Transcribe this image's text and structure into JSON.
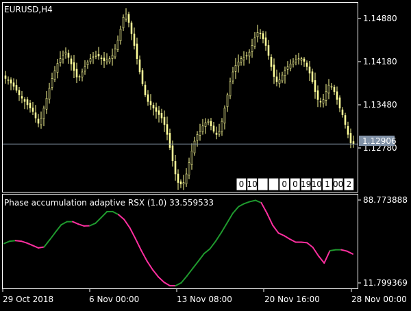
{
  "window": {
    "symbol_label": "EURUSD,H4"
  },
  "colors": {
    "background": "#000000",
    "frame": "#ffffff",
    "candles": "#ffff99",
    "rsx_up": "#1f9a2e",
    "rsx_down": "#ff2fa0",
    "current_price_line": "#8899aa",
    "price_marker_bg": "#8091a6"
  },
  "price_axis": {
    "labels": [
      "1.14880",
      "1.14180",
      "1.13480",
      "1.12780"
    ],
    "current_price": "1.12906"
  },
  "indicator": {
    "name": "Phase accumulation adaptive RSX (1.0)",
    "value": "33.559533",
    "scale_max": "88.773888",
    "scale_min": "11.799369"
  },
  "time_axis": {
    "labels": [
      "29 Oct 2018",
      "6 Nov 00:00",
      "13 Nov 08:00",
      "20 Nov 16:00",
      "28 Nov 00:00"
    ]
  },
  "period_boxes": [
    "0",
    "10",
    "",
    "",
    "0",
    "0",
    "19",
    "10",
    "1",
    "00",
    "2"
  ],
  "chart_data": [
    {
      "type": "candlestick",
      "title": "EURUSD,H4",
      "y_ticks": [
        1.1488,
        1.1418,
        1.1348,
        1.1278
      ],
      "ylim": [
        1.1218,
        1.1505
      ],
      "current_price": 1.12906,
      "x_tick_labels": [
        "29 Oct 2018",
        "6 Nov 00:00",
        "13 Nov 08:00",
        "20 Nov 16:00",
        "28 Nov 00:00"
      ],
      "close_path": [
        1.139,
        1.1388,
        1.1383,
        1.1378,
        1.1372,
        1.1365,
        1.136,
        1.1355,
        1.135,
        1.1345,
        1.134,
        1.133,
        1.1322,
        1.133,
        1.1345,
        1.136,
        1.1375,
        1.139,
        1.1402,
        1.1413,
        1.142,
        1.1425,
        1.143,
        1.1422,
        1.1412,
        1.1402,
        1.1392,
        1.1393,
        1.14,
        1.1408,
        1.1415,
        1.142,
        1.1423,
        1.1425,
        1.1424,
        1.142,
        1.1417,
        1.1418,
        1.142,
        1.1425,
        1.1435,
        1.1448,
        1.1465,
        1.1483,
        1.1488,
        1.1475,
        1.1458,
        1.144,
        1.142,
        1.14,
        1.1382,
        1.1365,
        1.1355,
        1.135,
        1.1345,
        1.134,
        1.1335,
        1.133,
        1.132,
        1.1305,
        1.1285,
        1.1265,
        1.1245,
        1.1232,
        1.123,
        1.1232,
        1.1245,
        1.1262,
        1.128,
        1.1295,
        1.1305,
        1.131,
        1.1318,
        1.1323,
        1.1325,
        1.1318,
        1.131,
        1.1305,
        1.131,
        1.1325,
        1.1345,
        1.1365,
        1.1385,
        1.14,
        1.141,
        1.1415,
        1.142,
        1.1422,
        1.1425,
        1.143,
        1.144,
        1.1452,
        1.146,
        1.1458,
        1.145,
        1.144,
        1.1425,
        1.1408,
        1.1393,
        1.1385,
        1.1388,
        1.1395,
        1.1402,
        1.1408,
        1.1412,
        1.1415,
        1.1418,
        1.142,
        1.142,
        1.1416,
        1.1408,
        1.1398,
        1.1385,
        1.137,
        1.1358,
        1.1355,
        1.1358,
        1.137,
        1.138,
        1.1378,
        1.137,
        1.1358,
        1.1345,
        1.1335,
        1.132,
        1.1305,
        1.1292,
        1.1291
      ]
    },
    {
      "type": "line",
      "title": "Phase accumulation adaptive RSX (1.0) 33.559533",
      "ylim": [
        11.799369,
        88.773888
      ],
      "x_tick_labels": [
        "29 Oct 2018",
        "6 Nov 00:00",
        "13 Nov 08:00",
        "20 Nov 16:00",
        "28 Nov 00:00"
      ],
      "values": [
        48.6,
        50.5,
        51.0,
        50.5,
        49.0,
        47.0,
        45.0,
        45.8,
        51.8,
        58.0,
        64.0,
        66.5,
        66.5,
        64.5,
        63.0,
        63.2,
        65.3,
        70.0,
        74.7,
        74.8,
        72.3,
        68.3,
        61.4,
        52.4,
        42.8,
        34.2,
        27.0,
        21.1,
        16.8,
        14.0,
        14.0,
        16.4,
        22.1,
        28.2,
        34.2,
        40.4,
        44.2,
        50.4,
        57.6,
        65.4,
        73.3,
        78.8,
        81.3,
        83.0,
        84.0,
        82.0,
        73.4,
        63.5,
        57.2,
        55.0,
        52.2,
        49.7,
        49.7,
        49.2,
        45.5,
        38.5,
        32.6,
        42.7,
        43.5,
        43.5,
        42.3,
        40.0
      ],
      "colors": [
        "#1f9a2e",
        "#ff2fa0"
      ],
      "segments_direction": [
        "up",
        "up",
        "down",
        "down",
        "down",
        "down",
        "down",
        "up",
        "up",
        "up",
        "up",
        "up",
        "down",
        "down",
        "down",
        "up",
        "up",
        "up",
        "up",
        "up",
        "down",
        "down",
        "down",
        "down",
        "down",
        "down",
        "down",
        "down",
        "down",
        "down",
        "up",
        "up",
        "up",
        "up",
        "up",
        "up",
        "up",
        "up",
        "up",
        "up",
        "up",
        "up",
        "up",
        "up",
        "up",
        "down",
        "down",
        "down",
        "down",
        "down",
        "down",
        "down",
        "down",
        "down",
        "down",
        "down",
        "down",
        "up",
        "up",
        "down",
        "down",
        "down"
      ]
    }
  ]
}
